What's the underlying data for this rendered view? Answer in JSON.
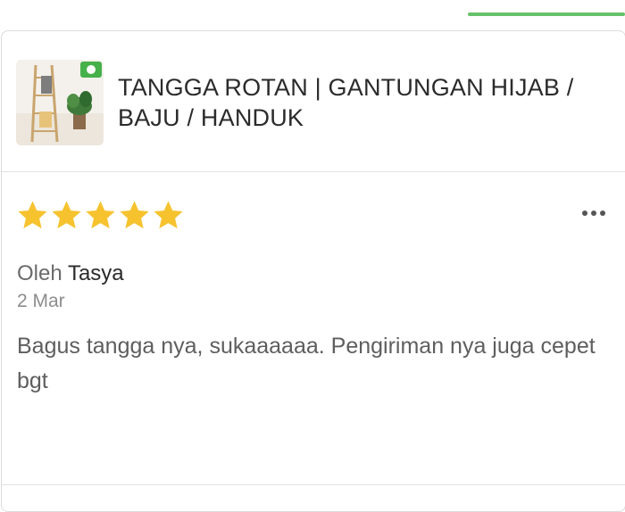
{
  "product": {
    "title": "TANGGA ROTAN | GANTUNGAN HIJAB / BAJU / HANDUK",
    "thumbnail_icon": "ladder-rack-photo"
  },
  "review": {
    "rating": 5,
    "rating_max": 5,
    "author_prefix": "Oleh",
    "author_name": "Tasya",
    "date": "2 Mar",
    "text": "Bagus tangga nya, sukaaaaaa. Pengiriman nya juga cepet bgt"
  },
  "colors": {
    "accent_green": "#67c26b",
    "star_yellow": "#f6c32f"
  },
  "icons": {
    "more": "more-horizontal-icon",
    "star": "star-icon"
  }
}
